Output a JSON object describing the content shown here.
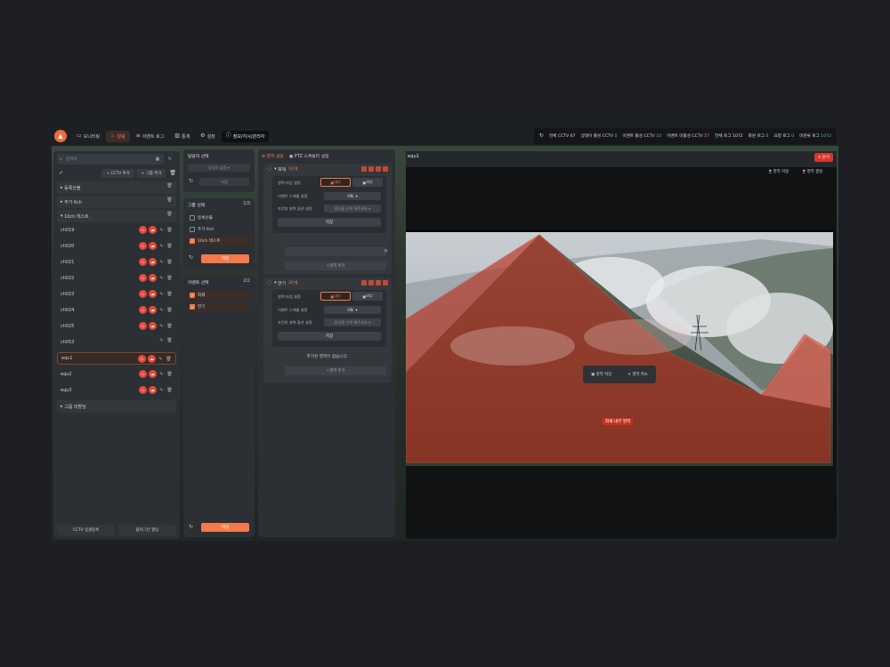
{
  "topbar": {
    "nav": [
      {
        "label": "모니터링",
        "icon": "monitor-icon"
      },
      {
        "label": "알림",
        "icon": "fire-icon"
      },
      {
        "label": "이벤트 로그",
        "icon": "list-icon"
      },
      {
        "label": "통계",
        "icon": "chart-icon"
      },
      {
        "label": "설정",
        "icon": "gear-icon"
      },
      {
        "label": "정보/지시/관리자",
        "icon": "info-icon"
      }
    ],
    "stats": [
      {
        "label": "전체 CCTV",
        "value": "67",
        "tone": "n"
      },
      {
        "label": "상태이 활성 CCTV",
        "value": "0",
        "tone": "g"
      },
      {
        "label": "이벤트 활성 CCTV",
        "value": "10",
        "tone": "g"
      },
      {
        "label": "이벤트 미활성 CCTV",
        "value": "57",
        "tone": "o"
      },
      {
        "label": "전체 로그",
        "value": "1072",
        "tone": "n"
      },
      {
        "label": "화원 로그",
        "value": "0",
        "tone": "g"
      },
      {
        "label": "요청 로그",
        "value": "0",
        "tone": "g"
      },
      {
        "label": "미분류 로그",
        "value": "1072",
        "tone": "g"
      }
    ]
  },
  "left": {
    "search_placeholder": "검색어",
    "add_cctv": "CCTV 추가",
    "add_group": "그룹 추가",
    "groups": [
      "등록산불",
      "추가 6ch",
      "10ch 테스트"
    ],
    "cameras": [
      "ch019",
      "ch020",
      "ch021",
      "ch022",
      "ch023",
      "ch024",
      "ch025",
      "ch053",
      "equ1",
      "equ2",
      "equ3"
    ],
    "unassigned": "그룹 미할당",
    "footer": [
      "CCTV 일괄등록",
      "플러그인 할당"
    ]
  },
  "mid": {
    "manager_title": "담당자 선택",
    "manager_select": "담당자 없음",
    "manager_save": "저장",
    "group_title": "그룹 선택",
    "group_count": "1/3",
    "group_items": [
      "등록산불",
      "추가 6ch",
      "10ch 테스트"
    ],
    "group_save": "저장",
    "event_title": "이벤트 선택",
    "event_count": "2/2",
    "event_items": [
      "화재",
      "연기"
    ],
    "event_save": "저장"
  },
  "events": {
    "tabs": [
      "영역 설정",
      "PTZ 스케줄러 설정"
    ],
    "fire": {
      "name": "화재",
      "level": "1단계"
    },
    "smoke": {
      "name": "연기",
      "level": "2단계"
    },
    "zone_type_label": "영역 타입 설정",
    "seg_inner": "내부",
    "seg_outer": "외부",
    "schedule_label": "이벤트 스케줄 설정",
    "schedule_value": "ON",
    "cond_label": "조건부 영역 옵션 설정",
    "cond_value": "옵션을 선택 해주세요",
    "save": "저장",
    "add_zone": "영역 추가",
    "no_zone": "추가된 영역이 없습니다."
  },
  "viewer": {
    "title": "equ1",
    "close": "닫기",
    "tool1": "영역 지정",
    "tool2": "영역 결정",
    "save_zone": "영역 저장",
    "cancel_zone": "영역 취소",
    "zone_label": "화재 내부 영역"
  }
}
